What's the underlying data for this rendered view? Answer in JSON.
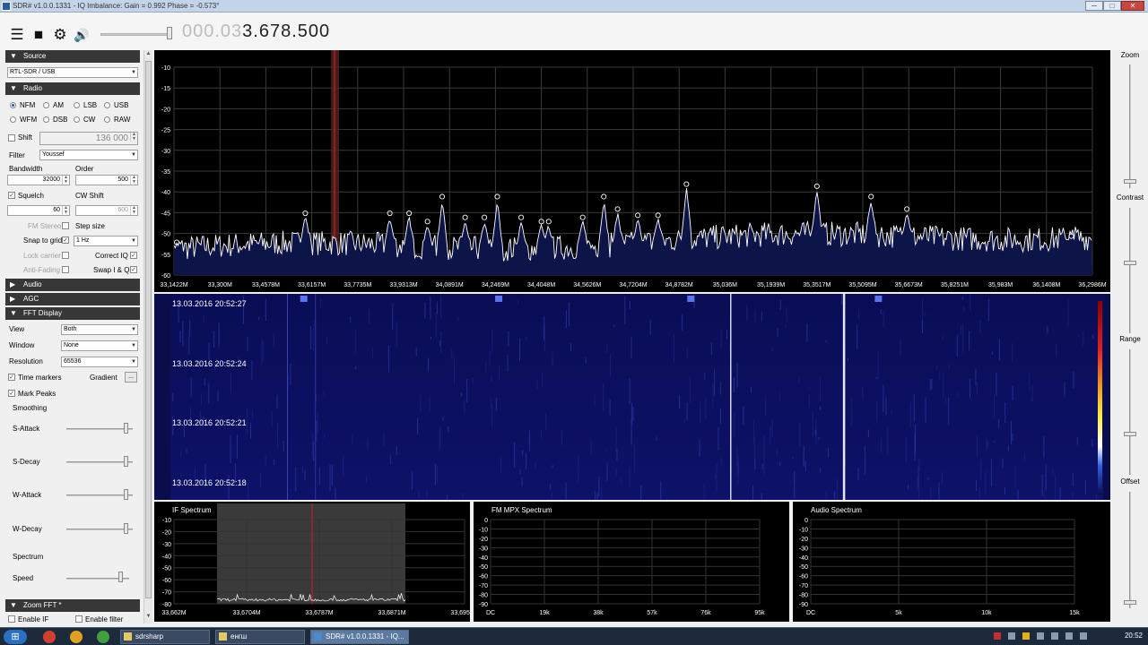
{
  "window": {
    "title": "SDR# v1.0.0.1331 - IQ Imbalance: Gain = 0.992 Phase = -0.573°",
    "min": "─",
    "max": "□",
    "close": "✕"
  },
  "toolbar": {
    "frequency_dim": "000.03",
    "frequency_main": "3.678.500",
    "volume": 0.95
  },
  "source": {
    "header": "Source",
    "device": "RTL-SDR / USB"
  },
  "radio": {
    "header": "Radio",
    "modes": [
      "NFM",
      "AM",
      "LSB",
      "USB",
      "WFM",
      "DSB",
      "CW",
      "RAW"
    ],
    "selected_mode": "NFM",
    "shift_label": "Shift",
    "shift_value": "136 000",
    "filter_label": "Filter",
    "filter_value": "Youssef",
    "bandwidth_label": "Bandwidth",
    "bandwidth_value": "32000",
    "order_label": "Order",
    "order_value": "500",
    "squelch_label": "Squelch",
    "squelch_value": "60",
    "cw_shift_label": "CW Shift",
    "cw_shift_value": "600",
    "fm_stereo_label": "FM Stereo",
    "step_size_label": "Step size",
    "snap_label": "Snap to grid",
    "snap_value": "1 Hz",
    "lock_carrier_label": "Lock carrier",
    "correct_iq_label": "Correct IQ",
    "anti_fading_label": "Anti-Fading",
    "swap_iq_label": "Swap I & Q"
  },
  "audio": {
    "header": "Audio"
  },
  "agc": {
    "header": "AGC"
  },
  "fft": {
    "header": "FFT Display",
    "view_label": "View",
    "view_value": "Both",
    "window_label": "Window",
    "window_value": "None",
    "resolution_label": "Resolution",
    "resolution_value": "65536",
    "time_markers_label": "Time markers",
    "gradient_label": "Gradient",
    "gradient_btn": "...",
    "mark_peaks_label": "Mark Peaks",
    "smoothing_label": "Smoothing",
    "s_attack_label": "S-Attack",
    "s_decay_label": "S-Decay",
    "w_attack_label": "W-Attack",
    "w_decay_label": "W-Decay",
    "spectrum_label": "Spectrum",
    "speed_label": "Speed"
  },
  "zoom_fft": {
    "header": "Zoom FFT *",
    "enable_if": "Enable IF",
    "enable_filter": "Enable filter"
  },
  "right_panel": {
    "zoom": "Zoom",
    "contrast": "Contrast",
    "range": "Range",
    "offset": "Offset"
  },
  "spectrum": {
    "y_ticks": [
      "-10",
      "-15",
      "-20",
      "-25",
      "-30",
      "-35",
      "-40",
      "-45",
      "-50",
      "-55",
      "-60"
    ],
    "x_ticks": [
      "33,1422M",
      "33,300M",
      "33,4578M",
      "33,6157M",
      "33,7735M",
      "33,9313M",
      "34,0891M",
      "34,2469M",
      "34,4048M",
      "34,5626M",
      "34,7204M",
      "34,8782M",
      "35,036M",
      "35,1939M",
      "35,3517M",
      "35,5095M",
      "35,6673M",
      "35,8251M",
      "35,983M",
      "36,1408M",
      "36,2986M"
    ]
  },
  "waterfall": {
    "timestamps": [
      "13.03.2016 20:52:27",
      "13.03.2016 20:52:24",
      "13.03.2016 20:52:21",
      "13.03.2016 20:52:18"
    ]
  },
  "if_spectrum": {
    "title": "IF Spectrum",
    "y_ticks": [
      "-10",
      "-20",
      "-30",
      "-40",
      "-50",
      "-60",
      "-70",
      "-80"
    ],
    "x_ticks": [
      "33,662M",
      "33,6704M",
      "33,6787M",
      "33,6871M",
      "33,6954M"
    ]
  },
  "fm_mpx": {
    "title": "FM MPX Spectrum",
    "y_ticks": [
      "0",
      "-10",
      "-20",
      "-30",
      "-40",
      "-50",
      "-60",
      "-70",
      "-80",
      "-90"
    ],
    "x_ticks": [
      "DC",
      "19k",
      "38k",
      "57k",
      "76k",
      "95k"
    ]
  },
  "audio_spectrum": {
    "title": "Audio Spectrum",
    "y_ticks": [
      "0",
      "-10",
      "-20",
      "-30",
      "-40",
      "-50",
      "-60",
      "-70",
      "-80",
      "-90"
    ],
    "x_ticks": [
      "DC",
      "5k",
      "10k",
      "15k"
    ]
  },
  "taskbar": {
    "tasks": [
      "sdrsharp",
      "енгш",
      "SDR# v1.0.0.1331 - IQ..."
    ],
    "clock": "20:52"
  },
  "colors": {
    "spectrum_line": "#ffffff",
    "spectrum_fill": "#0c1448",
    "waterfall_bg": "#0a0d4a",
    "section_header": "#373737"
  }
}
